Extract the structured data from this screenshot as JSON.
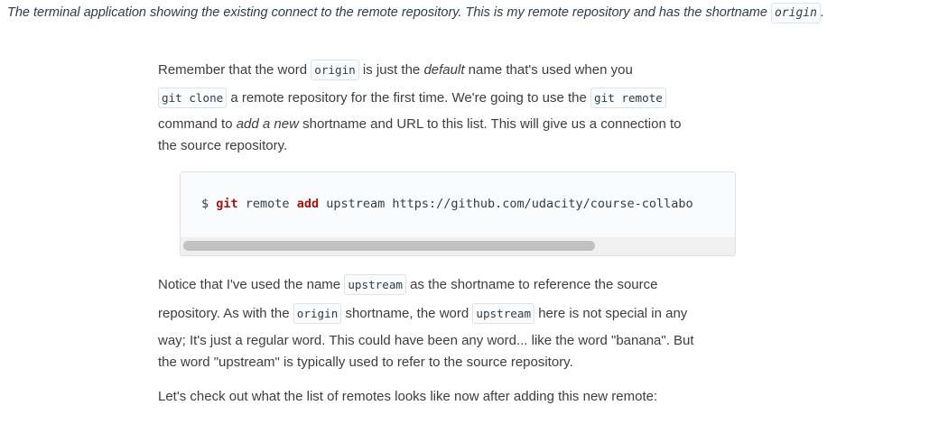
{
  "caption": {
    "text": "The terminal application showing the existing connect to the remote repository. This is my remote repository and has the shortname ",
    "code": "origin",
    "end": "."
  },
  "para1": {
    "t1": "Remember that the word ",
    "c1": "origin",
    "t2": " is just the ",
    "e1": "default",
    "t3": " name that's used when you",
    "c2": "git clone",
    "t4": " a remote repository for the first time. We're going to use the ",
    "c3": "git remote",
    "t5": "command to ",
    "e2": "add a new",
    "t6": " shortname and URL to this list. This will give us a connection to",
    "t7": "the source repository."
  },
  "code_block": {
    "prompt": "$ ",
    "cmd": "git",
    "sp1": " remote ",
    "sub": "add",
    "rest": " upstream https://github.com/udacity/course-collabo"
  },
  "para2": {
    "t1": "Notice that I've used the name ",
    "c1": "upstream",
    "t2": " as the shortname to reference the source",
    "t3": "repository. As with the ",
    "c2": "origin",
    "t4": " shortname, the word ",
    "c3": "upstream",
    "t5": " here is not special in any",
    "t6": "way; It's just a regular word. This could have been any word... like the word \"banana\". But",
    "t7": "the word \"upstream\" is typically used to refer to the source repository."
  },
  "para3": {
    "text": "Let's check out what the list of remotes looks like now after adding this new remote:"
  }
}
